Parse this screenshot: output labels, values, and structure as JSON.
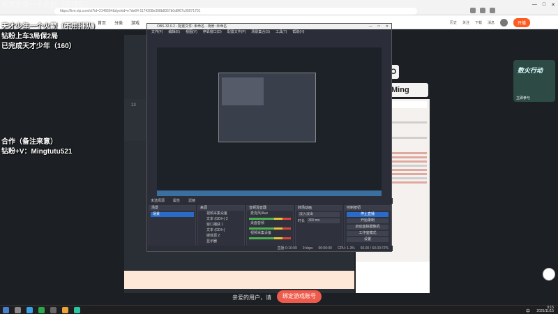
{
  "browser": {
    "url": "https://live.vip.com/ct?id=2146564&dyshid=e7de84-1174208e398b8357b0d8f67c00071701",
    "window_controls": [
      "—",
      "□",
      "✕"
    ]
  },
  "site_nav": {
    "items": [
      "首页",
      "分类",
      "游戏"
    ],
    "right_items": [
      "历史",
      "关注",
      "下载",
      "消息"
    ],
    "open_button": "开播"
  },
  "overlay": {
    "line_faded": "天才少年一个火箭（不排队）",
    "line1": "天才少年一个火箭（不用排队）",
    "line2": "钻粉上车3局保2局",
    "line3": "已完成天才少年（160）",
    "line4": "合作（备注来意）",
    "line5": "钻粉+V：Mingtutu521"
  },
  "stream": {
    "ming_label": "Ming",
    "o_label": "O",
    "viewer_count": "13",
    "promo_title": "数火行动",
    "promo_sub": "立即参与"
  },
  "obs": {
    "title": "OBS 32.0.2 - 配置文件: 未命名 - 场景: 未命名",
    "menu": [
      "文件(F)",
      "编辑(E)",
      "视图(V)",
      "停靠窗口(D)",
      "配置文件(P)",
      "场景集合(S)",
      "工具(T)",
      "帮助(H)"
    ],
    "status_items": [
      "未选择源",
      "属性",
      "滤镜"
    ],
    "docks": {
      "scenes": {
        "title": "场景",
        "items": [
          "场景"
        ]
      },
      "sources": {
        "title": "来源",
        "items": [
          "视频采集设备",
          "文本 (GDI+) 2",
          "窗口捕获 1",
          "文本 (GDI+)",
          "媒体源 2",
          "显示器"
        ]
      },
      "audio": {
        "title": "音频混音器",
        "channels": [
          "麦克风/Aux",
          "桌面音频",
          "视频采集设备"
        ]
      },
      "transitions": {
        "title": "转场动画",
        "type": "淡入淡出",
        "duration_label": "时长",
        "duration": "300 ms"
      },
      "controls": {
        "title": "控制按钮",
        "buttons": [
          "停止直播",
          "开始录制",
          "启动虚拟摄像机",
          "工作室模式",
          "设置",
          "退出"
        ]
      }
    },
    "footer": [
      "直播 0:10:09",
      "0 kbps",
      "00:00:00",
      "CPU: 1.3%",
      "60.00 / 60.00 FPS"
    ]
  },
  "page": {
    "cta_text": "亲爱的用户，请",
    "cta_button": "绑定游戏账号"
  },
  "taskbar": {
    "time": "9:15",
    "date": "2025/11/15",
    "lang": "中"
  }
}
